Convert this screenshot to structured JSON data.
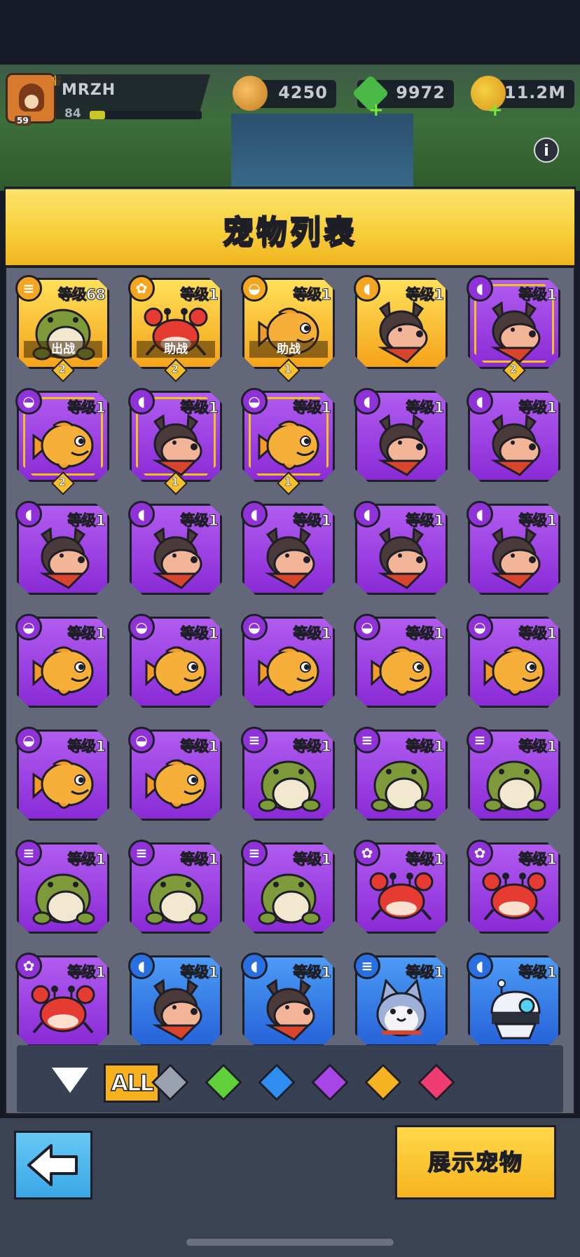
{
  "player": {
    "name": "MRZH",
    "level": "84",
    "avatar_level": "59",
    "xp_fraction": 0.14
  },
  "currencies": [
    {
      "name": "coin",
      "value": "4250"
    },
    {
      "name": "gem",
      "value": "9972"
    },
    {
      "name": "gold",
      "value": "11.2M"
    }
  ],
  "info_label": "i",
  "title": "宠物列表",
  "pets": [
    {
      "type": "frog",
      "rarity": "gold",
      "badge": "frog",
      "level": "等级68",
      "status": "出战",
      "stars": "2",
      "framed": false
    },
    {
      "type": "crab",
      "rarity": "gold",
      "badge": "crab",
      "level": "等级1",
      "status": "助战",
      "stars": "2",
      "framed": false
    },
    {
      "type": "fish",
      "rarity": "gold",
      "badge": "fish",
      "level": "等级1",
      "status": "助战",
      "stars": "1",
      "framed": false
    },
    {
      "type": "dog",
      "rarity": "gold",
      "badge": "dog",
      "level": "等级1",
      "status": "",
      "stars": "",
      "framed": false
    },
    {
      "type": "dog",
      "rarity": "purple",
      "badge": "dog",
      "level": "等级1",
      "status": "",
      "stars": "2",
      "framed": true
    },
    {
      "type": "fish",
      "rarity": "purple",
      "badge": "fish",
      "level": "等级1",
      "status": "",
      "stars": "2",
      "framed": true
    },
    {
      "type": "dog",
      "rarity": "purple",
      "badge": "dog",
      "level": "等级1",
      "status": "",
      "stars": "1",
      "framed": true
    },
    {
      "type": "fish",
      "rarity": "purple",
      "badge": "fish",
      "level": "等级1",
      "status": "",
      "stars": "1",
      "framed": true
    },
    {
      "type": "dog",
      "rarity": "purple",
      "badge": "dog",
      "level": "等级1",
      "status": "",
      "stars": "",
      "framed": false
    },
    {
      "type": "dog",
      "rarity": "purple",
      "badge": "dog",
      "level": "等级1",
      "status": "",
      "stars": "",
      "framed": false
    },
    {
      "type": "dog",
      "rarity": "purple",
      "badge": "dog",
      "level": "等级1",
      "status": "",
      "stars": "",
      "framed": false
    },
    {
      "type": "dog",
      "rarity": "purple",
      "badge": "dog",
      "level": "等级1",
      "status": "",
      "stars": "",
      "framed": false
    },
    {
      "type": "dog",
      "rarity": "purple",
      "badge": "dog",
      "level": "等级1",
      "status": "",
      "stars": "",
      "framed": false
    },
    {
      "type": "dog",
      "rarity": "purple",
      "badge": "dog",
      "level": "等级1",
      "status": "",
      "stars": "",
      "framed": false
    },
    {
      "type": "dog",
      "rarity": "purple",
      "badge": "dog",
      "level": "等级1",
      "status": "",
      "stars": "",
      "framed": false
    },
    {
      "type": "fish",
      "rarity": "purple",
      "badge": "fish",
      "level": "等级1",
      "status": "",
      "stars": "",
      "framed": false
    },
    {
      "type": "fish",
      "rarity": "purple",
      "badge": "fish",
      "level": "等级1",
      "status": "",
      "stars": "",
      "framed": false
    },
    {
      "type": "fish",
      "rarity": "purple",
      "badge": "fish",
      "level": "等级1",
      "status": "",
      "stars": "",
      "framed": false
    },
    {
      "type": "fish",
      "rarity": "purple",
      "badge": "fish",
      "level": "等级1",
      "status": "",
      "stars": "",
      "framed": false
    },
    {
      "type": "fish",
      "rarity": "purple",
      "badge": "fish",
      "level": "等级1",
      "status": "",
      "stars": "",
      "framed": false
    },
    {
      "type": "fish",
      "rarity": "purple",
      "badge": "fish",
      "level": "等级1",
      "status": "",
      "stars": "",
      "framed": false
    },
    {
      "type": "fish",
      "rarity": "purple",
      "badge": "fish",
      "level": "等级1",
      "status": "",
      "stars": "",
      "framed": false
    },
    {
      "type": "frog",
      "rarity": "purple",
      "badge": "frog",
      "level": "等级1",
      "status": "",
      "stars": "",
      "framed": false
    },
    {
      "type": "frog",
      "rarity": "purple",
      "badge": "frog",
      "level": "等级1",
      "status": "",
      "stars": "",
      "framed": false
    },
    {
      "type": "frog",
      "rarity": "purple",
      "badge": "frog",
      "level": "等级1",
      "status": "",
      "stars": "",
      "framed": false
    },
    {
      "type": "frog",
      "rarity": "purple",
      "badge": "frog",
      "level": "等级1",
      "status": "",
      "stars": "",
      "framed": false
    },
    {
      "type": "frog",
      "rarity": "purple",
      "badge": "frog",
      "level": "等级1",
      "status": "",
      "stars": "",
      "framed": false
    },
    {
      "type": "frog",
      "rarity": "purple",
      "badge": "frog",
      "level": "等级1",
      "status": "",
      "stars": "",
      "framed": false
    },
    {
      "type": "crab",
      "rarity": "purple",
      "badge": "crab",
      "level": "等级1",
      "status": "",
      "stars": "",
      "framed": false
    },
    {
      "type": "crab",
      "rarity": "purple",
      "badge": "crab",
      "level": "等级1",
      "status": "",
      "stars": "",
      "framed": false
    },
    {
      "type": "crab",
      "rarity": "purple",
      "badge": "crab",
      "level": "等级1",
      "status": "",
      "stars": "",
      "framed": false
    },
    {
      "type": "dog",
      "rarity": "blue",
      "badge": "dog",
      "level": "等级1",
      "status": "",
      "stars": "",
      "framed": false
    },
    {
      "type": "dog",
      "rarity": "blue",
      "badge": "dog",
      "level": "等级1",
      "status": "",
      "stars": "",
      "framed": false
    },
    {
      "type": "cat",
      "rarity": "blue",
      "badge": "frog",
      "level": "等级1",
      "status": "",
      "stars": "",
      "framed": false
    },
    {
      "type": "robot",
      "rarity": "blue",
      "badge": "dog",
      "level": "等级1",
      "status": "",
      "stars": "",
      "framed": false
    }
  ],
  "filter": {
    "all_label": "ALL",
    "gems": [
      {
        "name": "gray-gem",
        "color": "#9aa2b2"
      },
      {
        "name": "green-gem",
        "color": "#5fd03a"
      },
      {
        "name": "blue-gem",
        "color": "#2f8df0"
      },
      {
        "name": "purple-gem",
        "color": "#a646e6"
      },
      {
        "name": "orange-gem",
        "color": "#f6b423"
      },
      {
        "name": "red-gem",
        "color": "#ef3d72"
      }
    ]
  },
  "buttons": {
    "show_pet": "展示宠物"
  }
}
